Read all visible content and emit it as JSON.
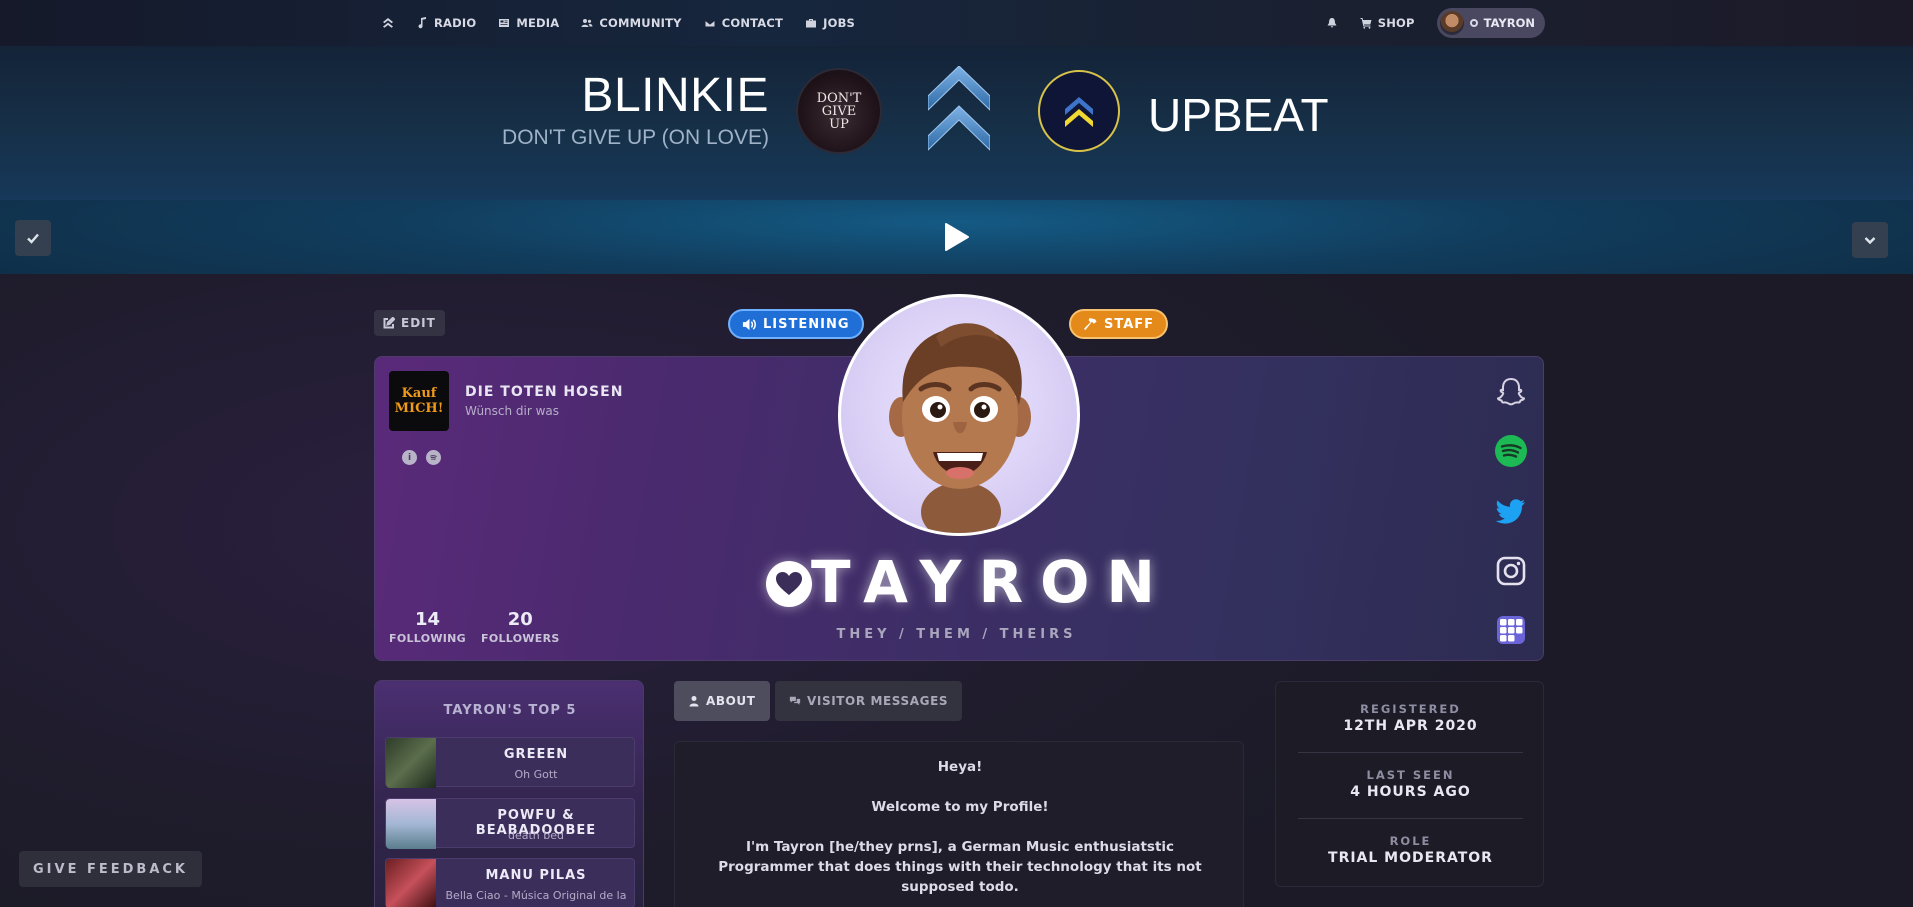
{
  "nav": {
    "items": [
      {
        "label": "RADIO",
        "icon": "music-note-icon"
      },
      {
        "label": "MEDIA",
        "icon": "newspaper-icon"
      },
      {
        "label": "COMMUNITY",
        "icon": "users-icon"
      },
      {
        "label": "CONTACT",
        "icon": "envelope-icon"
      },
      {
        "label": "JOBS",
        "icon": "briefcase-icon"
      }
    ],
    "shop_label": "SHOP",
    "user_label": "TAYRON"
  },
  "now_playing": {
    "artist": "BLINKIE",
    "song": "DON'T GIVE UP (ON LOVE)",
    "cover_text": "DON'T GIVE UP",
    "station": "UPBEAT"
  },
  "profile": {
    "edit_label": "EDIT",
    "listening_label": "LISTENING",
    "staff_label": "STAFF",
    "current_track": {
      "cover_text": "Kauf MICH!",
      "artist": "DIE TOTEN HOSEN",
      "song": "Wünsch dir was"
    },
    "following_count": "14",
    "following_label": "FOLLOWING",
    "followers_count": "20",
    "followers_label": "FOLLOWERS",
    "username": "TAYRON",
    "pronouns": "THEY / THEM / THEIRS",
    "socials": [
      "snapchat-icon",
      "spotify-icon",
      "twitter-icon",
      "instagram-icon",
      "apps-icon"
    ]
  },
  "top5": {
    "title": "TAYRON'S TOP 5",
    "items": [
      {
        "artist": "GREEEN",
        "song": "Oh Gott"
      },
      {
        "artist": "POWFU & BEABADOOBEE",
        "song": "death bed"
      },
      {
        "artist": "MANU PILAS",
        "song": "Bella Ciao - Música Original de la"
      }
    ]
  },
  "tabs": {
    "about_label": "ABOUT",
    "visitor_label": "VISITOR MESSAGES"
  },
  "about": {
    "greeting": "Heya!",
    "welcome": "Welcome to my Profile!",
    "bio": "I'm Tayron [he/they prns], a German Music enthusiatstic Programmer that does things with their technology that its not supposed todo."
  },
  "stats": {
    "registered_label": "REGISTERED",
    "registered_value": "12TH APR 2020",
    "last_seen_label": "LAST SEEN",
    "last_seen_value": "4 HOURS AGO",
    "role_label": "ROLE",
    "role_value": "TRIAL MODERATOR"
  },
  "feedback_label": "GIVE FEEDBACK",
  "colors": {
    "listening": "#1f6fd6",
    "staff": "#e48a1a",
    "spotify": "#1db954",
    "twitter": "#1da1f2"
  }
}
